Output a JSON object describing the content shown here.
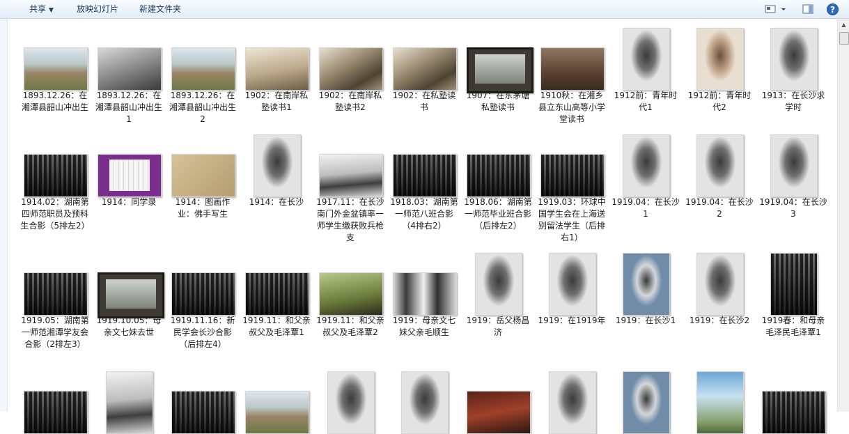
{
  "toolbar": {
    "share_label": "共享",
    "slideshow_label": "放映幻灯片",
    "new_folder_label": "新建文件夹",
    "view_icon": "view-options-icon",
    "preview_pane_icon": "preview-pane-icon",
    "help_icon": "help-icon"
  },
  "accent_color": "#1e395b",
  "files": [
    {
      "label": "1893.12.26：在湘潭县韶山冲出生",
      "kind": "t-land",
      "shape": "land"
    },
    {
      "label": "1893.12.26：在湘潭县韶山冲出生1",
      "kind": "t-bw",
      "shape": "land"
    },
    {
      "label": "1893.12.26：在湘潭县韶山冲出生2",
      "kind": "t-land",
      "shape": "land"
    },
    {
      "label": "1902：在南岸私塾读书1",
      "kind": "t-sepia",
      "shape": "land"
    },
    {
      "label": "1902：在南岸私塾读书2",
      "kind": "t-tree",
      "shape": "land"
    },
    {
      "label": "1902：在私塾读书",
      "kind": "t-tree",
      "shape": "land"
    },
    {
      "label": "1907：在东茅塘私塾读书",
      "kind": "t-frame",
      "shape": "land"
    },
    {
      "label": "1910秋：在湘乡县立东山高等小学堂读书",
      "kind": "t-room",
      "shape": "land"
    },
    {
      "label": "1912前：青年时代1",
      "kind": "t-portrait",
      "shape": "port"
    },
    {
      "label": "1912前：青年时代2",
      "kind": "t-portrait-color",
      "shape": "port"
    },
    {
      "label": "1913：在长沙求学时",
      "kind": "t-portrait",
      "shape": "port"
    },
    {
      "label": "1914.02：湖南第四师范职员及预科生合影（5排左2）",
      "kind": "t-group",
      "shape": "land"
    },
    {
      "label": "1914：同学录",
      "kind": "t-purple",
      "shape": "land"
    },
    {
      "label": "1914：图画作业：佛手写生",
      "kind": "t-paper",
      "shape": "land"
    },
    {
      "label": "1914：在长沙",
      "kind": "t-portrait",
      "shape": "port"
    },
    {
      "label": "1917.11：在长沙南门外金盆镇率一师学生缴获败兵枪支",
      "kind": "t-snow",
      "shape": "land"
    },
    {
      "label": "1918.03：湖南第一师范八班合影（4排右2）",
      "kind": "t-group",
      "shape": "land"
    },
    {
      "label": "1918.06：湖南第一师范毕业班合影（后排左2）",
      "kind": "t-group",
      "shape": "land"
    },
    {
      "label": "1919.03：环球中国学生会在上海送别留法学生（后排右1）",
      "kind": "t-group",
      "shape": "land"
    },
    {
      "label": "1919.04：在长沙1",
      "kind": "t-portrait",
      "shape": "port"
    },
    {
      "label": "1919.04：在长沙2",
      "kind": "t-portrait",
      "shape": "port"
    },
    {
      "label": "1919.04：在长沙3",
      "kind": "t-portrait",
      "shape": "port"
    },
    {
      "label": "1919.05：湖南第一师范湘潭学友会合影（2排左3）",
      "kind": "t-group",
      "shape": "land"
    },
    {
      "label": "1919.10.05：母亲文七妹去世",
      "kind": "t-frame",
      "shape": "land"
    },
    {
      "label": "1919.11.16：新民学会长沙合影（后排左4）",
      "kind": "t-group",
      "shape": "land"
    },
    {
      "label": "1919.11：和父亲叔父及毛泽覃1",
      "kind": "t-group",
      "shape": "land"
    },
    {
      "label": "1919.11：和父亲叔父及毛泽覃2",
      "kind": "t-green",
      "shape": "land"
    },
    {
      "label": "1919：母亲文七妹父亲毛顺生",
      "kind": "t-two",
      "shape": "land"
    },
    {
      "label": "1919：岳父杨昌济",
      "kind": "t-portrait",
      "shape": "port"
    },
    {
      "label": "1919：在1919年",
      "kind": "t-portrait",
      "shape": "port"
    },
    {
      "label": "1919：在长沙1",
      "kind": "t-bluebg",
      "shape": "port"
    },
    {
      "label": "1919：在长沙2",
      "kind": "t-portrait",
      "shape": "port"
    },
    {
      "label": "1919春：和母亲毛泽民毛泽覃1",
      "kind": "t-group",
      "shape": "port"
    },
    {
      "label": "",
      "kind": "t-group",
      "shape": "land"
    },
    {
      "label": "",
      "kind": "t-snow",
      "shape": "port"
    },
    {
      "label": "",
      "kind": "t-group",
      "shape": "land"
    },
    {
      "label": "",
      "kind": "t-land",
      "shape": "land"
    },
    {
      "label": "",
      "kind": "t-portrait",
      "shape": "port"
    },
    {
      "label": "",
      "kind": "t-portrait",
      "shape": "port"
    },
    {
      "label": "",
      "kind": "t-redfloor",
      "shape": "land"
    },
    {
      "label": "",
      "kind": "t-portrait",
      "shape": "port"
    },
    {
      "label": "",
      "kind": "t-bluebg",
      "shape": "port"
    },
    {
      "label": "",
      "kind": "t-poster",
      "shape": "port"
    },
    {
      "label": "",
      "kind": "t-group",
      "shape": "land"
    }
  ]
}
